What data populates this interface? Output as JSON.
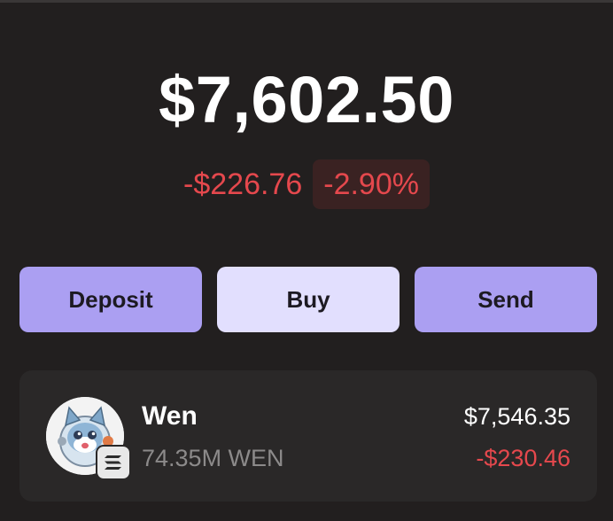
{
  "portfolio": {
    "balance": "$7,602.50",
    "change_amount": "-$226.76",
    "change_percent": "-2.90%"
  },
  "actions": {
    "deposit_label": "Deposit",
    "buy_label": "Buy",
    "send_label": "Send"
  },
  "tokens": [
    {
      "name": "Wen",
      "amount": "74.35M WEN",
      "value": "$7,546.35",
      "change": "-$230.46",
      "avatar_icon": "cat-astronaut-token-icon",
      "chain_icon": "solana-icon"
    }
  ],
  "colors": {
    "background": "#221f1f",
    "negative": "#e5484d",
    "button_primary": "#ab9ff2",
    "button_light": "#e2dffe",
    "card": "#2a2828",
    "muted_text": "#8c8a8a"
  }
}
